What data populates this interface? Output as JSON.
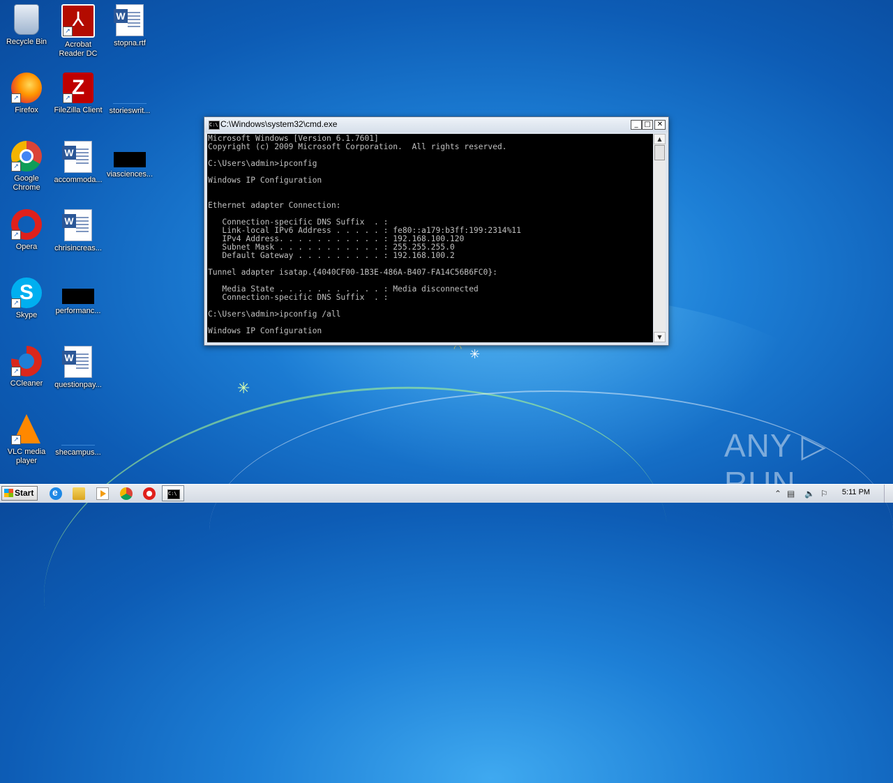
{
  "desktop": {
    "icons": [
      {
        "label": "Recycle Bin",
        "icon": "recycle-bin-icon"
      },
      {
        "label": "Acrobat\nReader DC",
        "icon": "acrobat-reader-icon"
      },
      {
        "label": "stopna.rtf",
        "icon": "word-document-icon"
      },
      {
        "label": "Firefox",
        "icon": "firefox-icon"
      },
      {
        "label": "FileZilla Client",
        "icon": "filezilla-icon"
      },
      {
        "label": "storieswrit...",
        "icon": "blank-file-icon"
      },
      {
        "label": "Google\nChrome",
        "icon": "chrome-icon"
      },
      {
        "label": "accommoda...",
        "icon": "word-document-icon"
      },
      {
        "label": "viasciences...",
        "icon": "black-thumbnail-icon"
      },
      {
        "label": "Opera",
        "icon": "opera-icon"
      },
      {
        "label": "chrisincreas...",
        "icon": "word-document-icon"
      },
      {
        "label": "Skype",
        "icon": "skype-icon"
      },
      {
        "label": "performanc...",
        "icon": "black-thumbnail-icon"
      },
      {
        "label": "CCleaner",
        "icon": "ccleaner-icon"
      },
      {
        "label": "questionpay...",
        "icon": "word-document-icon"
      },
      {
        "label": "VLC media\nplayer",
        "icon": "vlc-icon"
      },
      {
        "label": "shecampus...",
        "icon": "blank-file-icon"
      }
    ]
  },
  "cmd_window": {
    "title": "C:\\Windows\\system32\\cmd.exe",
    "minimize": "_",
    "maximize": "□",
    "close": "✕",
    "output": "Microsoft Windows [Version 6.1.7601]\nCopyright (c) 2009 Microsoft Corporation.  All rights reserved.\n\nC:\\Users\\admin>ipconfig\n\nWindows IP Configuration\n\n\nEthernet adapter Connection:\n\n   Connection-specific DNS Suffix  . :\n   Link-local IPv6 Address . . . . . : fe80::a179:b3ff:199:2314%11\n   IPv4 Address. . . . . . . . . . . : 192.168.100.120\n   Subnet Mask . . . . . . . . . . . : 255.255.255.0\n   Default Gateway . . . . . . . . . : 192.168.100.2\n\nTunnel adapter isatap.{4040CF00-1B3E-486A-B407-FA14C56B6FC0}:\n\n   Media State . . . . . . . . . . . : Media disconnected\n   Connection-specific DNS Suffix  . :\n\nC:\\Users\\admin>ipconfig /all\n\nWindows IP Configuration"
  },
  "watermark": "ANY ▷ RUN",
  "taskbar": {
    "start_label": "Start",
    "clock": "5:11 PM",
    "tray_up": "⌃",
    "tray_network": "▤",
    "tray_volume": "🔈",
    "tray_flag": "⚐"
  }
}
